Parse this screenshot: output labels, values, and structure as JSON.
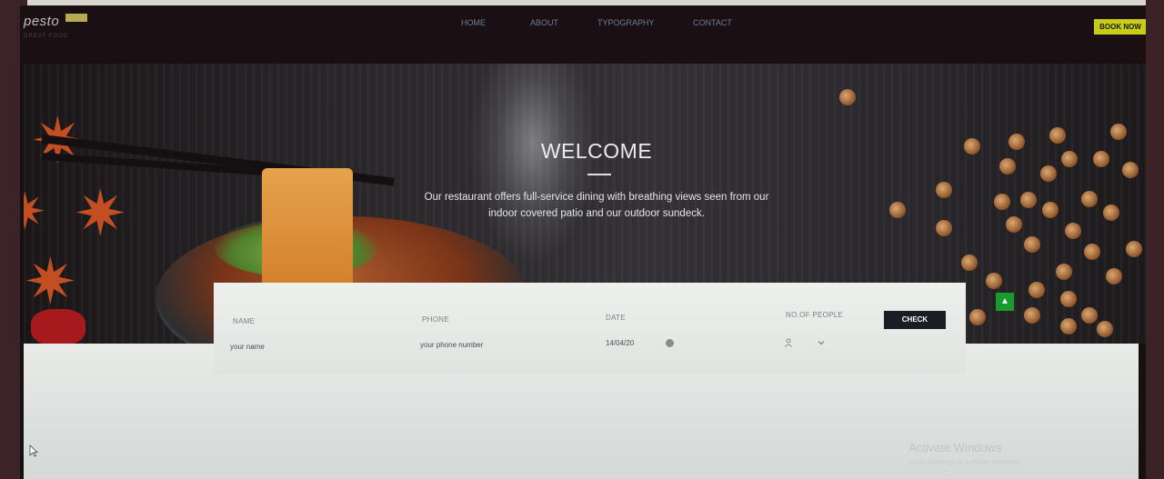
{
  "logo": {
    "text": "pesto",
    "sub": "GREAT FOOD"
  },
  "nav": {
    "items": [
      "HOME",
      "ABOUT",
      "TYPOGRAPHY",
      "CONTACT"
    ],
    "cta": "BOOK NOW"
  },
  "hero": {
    "title": "WELCOME",
    "text": "Our restaurant offers full-service dining with breathing views seen from our indoor covered patio and our outdoor sundeck."
  },
  "booking": {
    "name_label": "NAME",
    "name_placeholder": "your name",
    "phone_label": "PHONE",
    "phone_placeholder": "your phone number",
    "date_label": "DATE",
    "date_value": "14/04/20",
    "people_label": "NO.OF PEOPLE",
    "check_label": "CHECK"
  },
  "os": {
    "activate_title": "Activate Windows",
    "activate_sub": "Go to Settings to activate Windows."
  },
  "colors": {
    "accent": "#c8cb17",
    "nav_link": "#6f7d9e",
    "check_button": "#1c1c26",
    "scroll_up": "#1a9a2c"
  },
  "icons": [
    "calendar-icon",
    "person-icon",
    "chevron-down-icon",
    "chevron-up-icon",
    "mouse-cursor-icon"
  ]
}
